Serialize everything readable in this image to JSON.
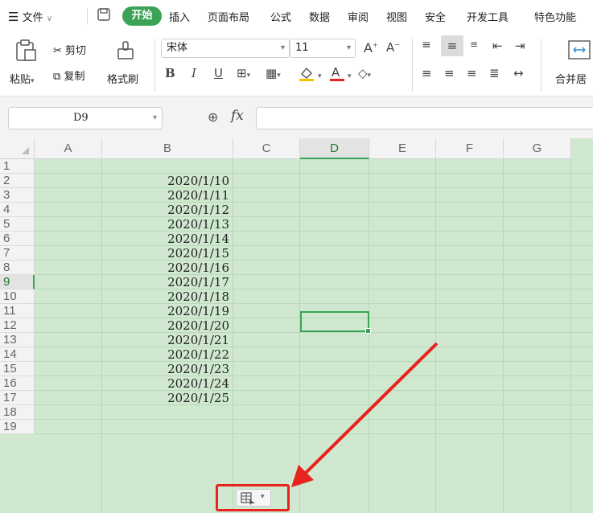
{
  "menu": {
    "file": "文件",
    "tabs": [
      {
        "label": "开始"
      },
      {
        "label": "插入"
      },
      {
        "label": "页面布局"
      },
      {
        "label": "公式"
      },
      {
        "label": "数据"
      },
      {
        "label": "审阅"
      },
      {
        "label": "视图"
      },
      {
        "label": "安全"
      },
      {
        "label": "开发工具"
      },
      {
        "label": "特色功能"
      }
    ],
    "active_color": "#3aa356"
  },
  "ribbon": {
    "paste": "粘贴",
    "cut": "剪切",
    "copy": "复制",
    "format_painter": "格式刷",
    "font_name": "宋体",
    "font_size": "11",
    "merge": "合并居",
    "bold": "B",
    "italic": "I",
    "underline": "U"
  },
  "formula_bar": {
    "name_box": "D9",
    "fx": "fx",
    "value": ""
  },
  "grid": {
    "columns": [
      "A",
      "B",
      "C",
      "D",
      "E",
      "F",
      "G"
    ],
    "selected_column": "D",
    "rows": [
      "1",
      "2",
      "3",
      "4",
      "5",
      "6",
      "7",
      "8",
      "9",
      "10",
      "11",
      "12",
      "13",
      "14",
      "15",
      "16",
      "17",
      "18",
      "19"
    ],
    "selected_row": "9",
    "column_b_values": [
      "",
      "2020/1/10",
      "2020/1/11",
      "2020/1/12",
      "2020/1/13",
      "2020/1/14",
      "2020/1/15",
      "2020/1/16",
      "2020/1/17",
      "2020/1/18",
      "2020/1/19",
      "2020/1/20",
      "2020/1/21",
      "2020/1/22",
      "2020/1/23",
      "2020/1/24",
      "2020/1/25",
      "",
      ""
    ],
    "background_color": "#cfe8cf",
    "highlight_color": "#e8221c"
  }
}
